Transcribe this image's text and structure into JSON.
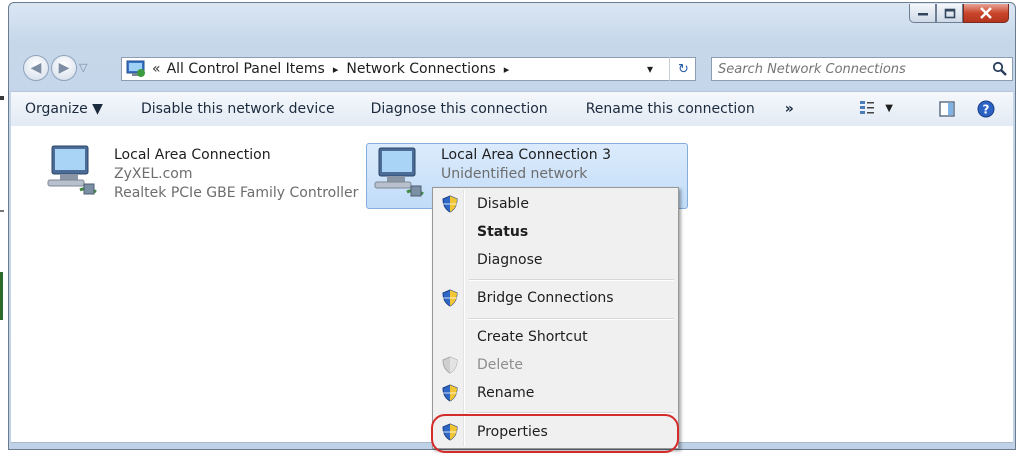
{
  "window": {
    "caption_buttons": [
      "minimize-icon",
      "maximize-icon",
      "close-icon"
    ]
  },
  "address_bar": {
    "overflow_glyph": "«",
    "crumbs": [
      "All Control Panel Items",
      "Network Connections"
    ],
    "separator": "▸",
    "dropdown_glyph": "▾",
    "refresh_glyph": "↻"
  },
  "search": {
    "placeholder": "Search Network Connections"
  },
  "toolbar": {
    "organize": "Organize ▼",
    "disable": "Disable this network device",
    "diagnose": "Diagnose this connection",
    "rename": "Rename this connection",
    "more": "»",
    "views_caret": "▼"
  },
  "connections": [
    {
      "name": "Local Area Connection",
      "network": "ZyXEL.com",
      "adapter": "Realtek PCIe GBE Family Controller"
    },
    {
      "name": "Local Area Connection 3",
      "network": "Unidentified network"
    }
  ],
  "context_menu": {
    "items": [
      {
        "label": "Disable",
        "shield": "active",
        "bold": false
      },
      {
        "label": "Status",
        "shield": "none",
        "bold": true
      },
      {
        "label": "Diagnose",
        "shield": "none",
        "bold": false
      },
      {
        "label": "Bridge Connections",
        "shield": "active",
        "bold": false
      },
      {
        "label": "Create Shortcut",
        "shield": "none",
        "bold": false
      },
      {
        "label": "Delete",
        "shield": "disabled",
        "bold": false,
        "disabled": true
      },
      {
        "label": "Rename",
        "shield": "active",
        "bold": false
      },
      {
        "label": "Properties",
        "shield": "active",
        "bold": false
      }
    ]
  },
  "colors": {
    "highlight_ring": "#d42b2b",
    "selection": "#c1dcf8"
  }
}
